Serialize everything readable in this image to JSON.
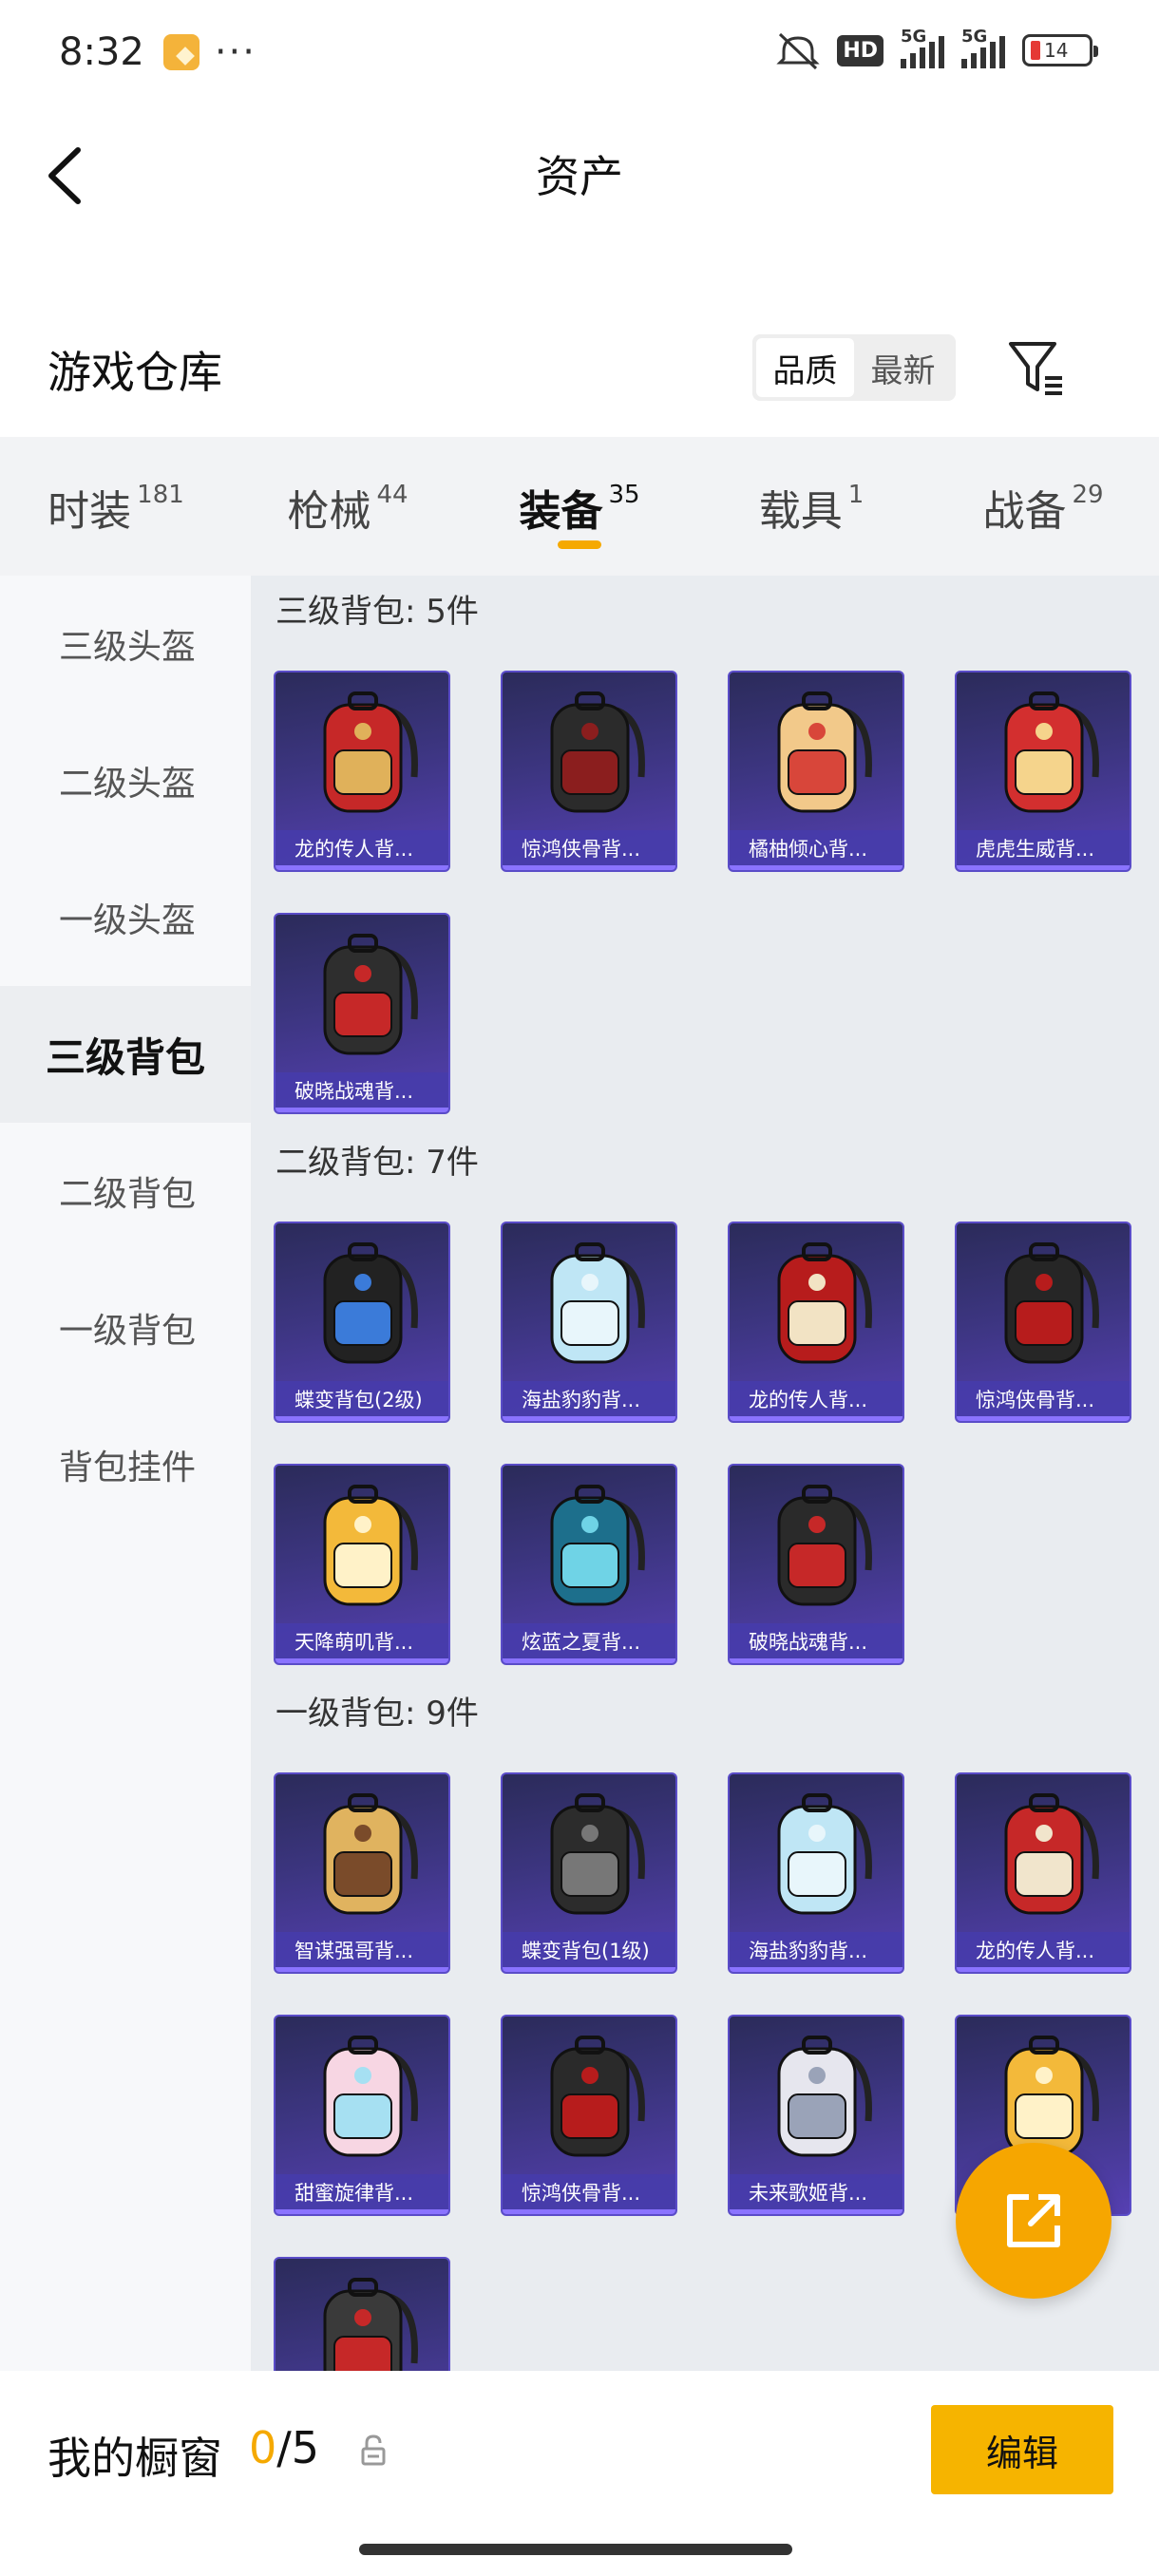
{
  "status_bar": {
    "time": "8:32",
    "dots": "···",
    "hd": "HD",
    "signal1": "5G",
    "signal2": "5G",
    "battery": "14"
  },
  "header": {
    "title": "资产",
    "back_icon": "back-arrow-icon"
  },
  "warehouse": {
    "title": "游戏仓库",
    "sort_options": [
      "品质",
      "最新"
    ],
    "sort_selected": "品质",
    "filter_icon": "filter-icon"
  },
  "category_tabs": [
    {
      "name": "时装",
      "count": "181"
    },
    {
      "name": "枪械",
      "count": "44"
    },
    {
      "name": "装备",
      "count": "35"
    },
    {
      "name": "载具",
      "count": "1"
    },
    {
      "name": "战备",
      "count": "29"
    }
  ],
  "active_tab": "装备",
  "sidebar": {
    "items": [
      "三级头盔",
      "二级头盔",
      "一级头盔",
      "三级背包",
      "二级背包",
      "一级背包",
      "背包挂件"
    ],
    "active": "三级背包"
  },
  "sections": [
    {
      "title": "三级背包: 5件",
      "items": [
        "龙的传人背...",
        "惊鸿侠骨背...",
        "橘柚倾心背...",
        "虎虎生威背...",
        "破晓战魂背..."
      ]
    },
    {
      "title": "二级背包: 7件",
      "items": [
        "蝶变背包(2级)",
        "海盐豹豹背...",
        "龙的传人背...",
        "惊鸿侠骨背...",
        "天降萌叽背...",
        "炫蓝之夏背...",
        "破晓战魂背..."
      ]
    },
    {
      "title": "一级背包: 9件",
      "items": [
        "智谋强哥背...",
        "蝶变背包(1级)",
        "海盐豹豹背...",
        "龙的传人背...",
        "甜蜜旋律背...",
        "惊鸿侠骨背...",
        "未来歌姬背...",
        "",
        ""
      ]
    }
  ],
  "colors": {
    "accent": "#f5a900",
    "card_bg": "#3c3580",
    "card_label": "#463caa"
  },
  "fab_icon": "share-icon",
  "bottom_bar": {
    "label": "我的橱窗",
    "current": "0",
    "total": "/5",
    "lock_icon": "lock-icon",
    "edit_label": "编辑"
  }
}
